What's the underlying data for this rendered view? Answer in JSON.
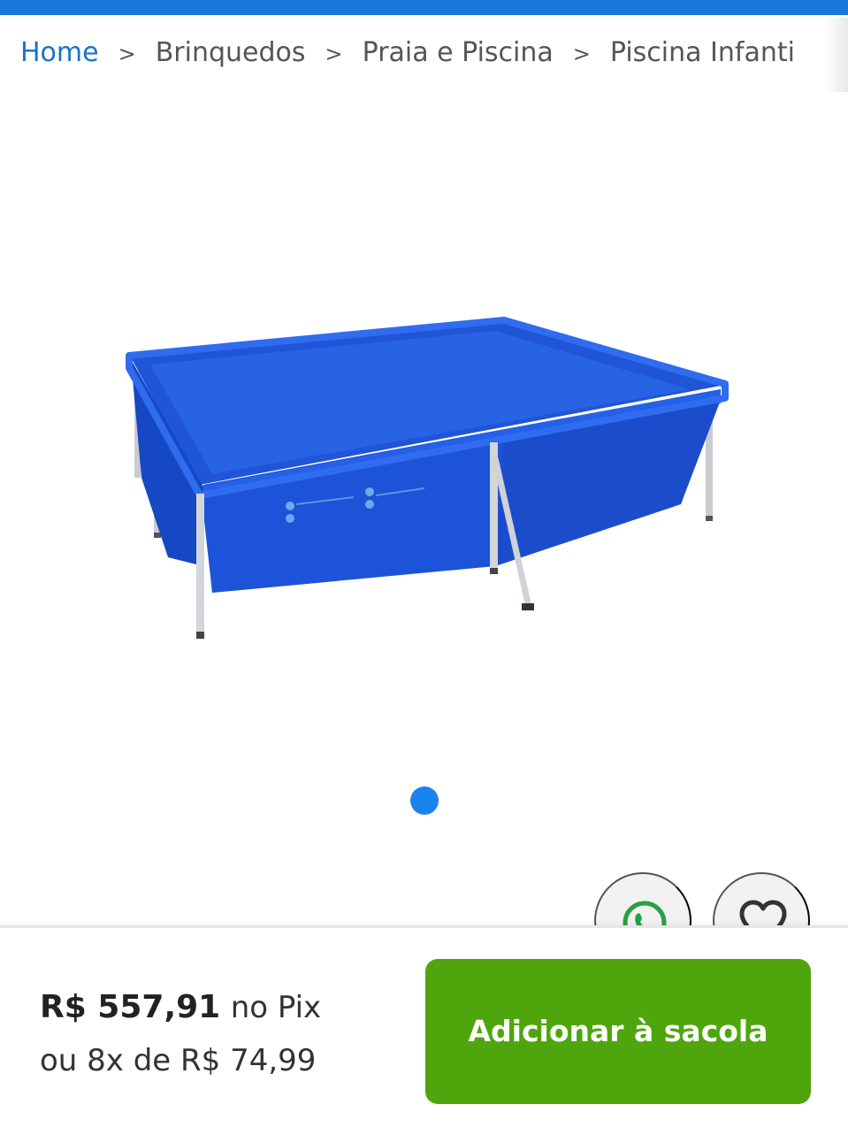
{
  "breadcrumb": {
    "items": [
      "Home",
      "Brinquedos",
      "Praia e Piscina",
      "Piscina Infanti"
    ],
    "separator": ">"
  },
  "product": {
    "image_icon": "rectangular-frame-pool-image"
  },
  "carousel": {
    "current": 1,
    "total": 1
  },
  "actions": {
    "whatsapp_icon": "whatsapp-icon",
    "favorite_icon": "heart-icon"
  },
  "price": {
    "value": "R$ 557,91",
    "suffix": "no Pix",
    "installments": "ou 8x de R$ 74,99"
  },
  "cta": {
    "label": "Adicionar à sacola"
  },
  "colors": {
    "top_bar": "#1677d8",
    "link": "#1a73c6",
    "dot": "#1a84ee",
    "cta": "#4ea60c",
    "whatsapp": "#25a244"
  }
}
